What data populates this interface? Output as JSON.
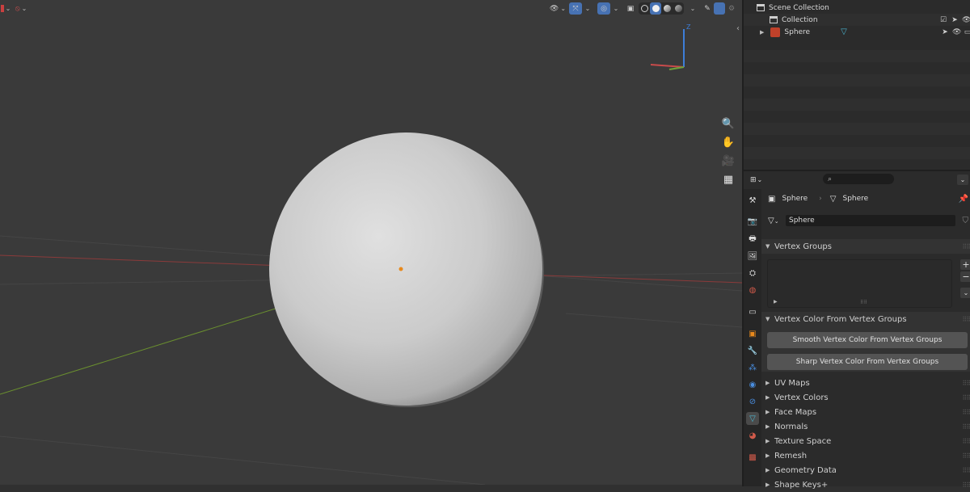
{
  "viewport": {
    "header_icons": [
      "view-object-types-icon",
      "gizmo-icon",
      "overlay-icon",
      "xray-icon",
      "shading-wireframe-icon",
      "shading-solid-icon",
      "shading-material-icon",
      "shading-rendered-icon"
    ],
    "axis_labels": {
      "z": "Z",
      "y": "Y",
      "x": "X"
    },
    "nav_tools": [
      "zoom-icon",
      "pan-hand-icon",
      "camera-view-icon",
      "ortho-grid-icon"
    ],
    "colors": {
      "x_axis": "#8b3a3a",
      "y_axis": "#6a8f2f",
      "z_gizmo": "#3d7ed8",
      "object_origin": "#e8891c"
    }
  },
  "outliner": {
    "rows": [
      {
        "label": "Scene Collection",
        "icon": "scene-collection-icon"
      },
      {
        "label": "Collection",
        "icon": "collection-icon"
      },
      {
        "label": "Sphere",
        "icon": "mesh-object-icon"
      }
    ]
  },
  "properties": {
    "search_placeholder": "",
    "breadcrumb": {
      "object": "Sphere",
      "mesh": "Sphere"
    },
    "datablock_name": "Sphere",
    "panels": {
      "vertex_groups": "Vertex Groups",
      "vertex_color_from_groups": "Vertex Color From Vertex Groups",
      "smooth_button": "Smooth Vertex Color From Vertex Groups",
      "sharp_button": "Sharp Vertex Color From Vertex Groups",
      "collapsed": [
        "UV Maps",
        "Vertex Colors",
        "Face Maps",
        "Normals",
        "Texture Space",
        "Remesh",
        "Geometry Data",
        "Shape Keys+"
      ]
    },
    "tabs": [
      "tool",
      "render",
      "output",
      "view-layer",
      "scene",
      "world",
      "collection",
      "object",
      "modifiers",
      "particles",
      "physics",
      "constraints",
      "data",
      "material",
      "texture"
    ],
    "active_tab": "data"
  }
}
